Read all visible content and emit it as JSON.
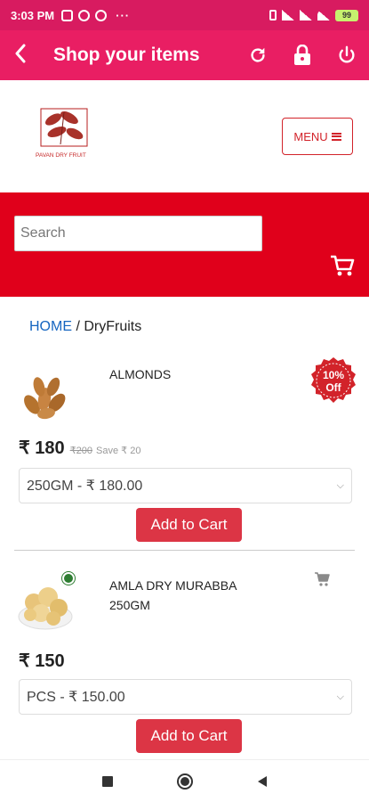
{
  "status_bar": {
    "time": "3:03 PM",
    "dots": "···",
    "battery": "99"
  },
  "app_bar": {
    "title": "Shop your items"
  },
  "header": {
    "menu_label": "MENU",
    "logo_text": "PAVAN DRY FRUIT"
  },
  "search": {
    "placeholder": "Search"
  },
  "breadcrumb": {
    "home": "HOME",
    "separator": " / ",
    "current": "DryFruits"
  },
  "products": [
    {
      "name": "ALMONDS",
      "price": "₹ 180",
      "old_price": "₹200",
      "save": "Save ₹ 20",
      "variant": "250GM - ₹ 180.00",
      "button": "Add to Cart",
      "discount_line1": "10%",
      "discount_line2": "Off"
    },
    {
      "name": "AMLA DRY MURABBA 250GM",
      "price": "₹ 150",
      "variant": "PCS - ₹ 150.00",
      "button": "Add to Cart"
    }
  ],
  "colors": {
    "status_bar": "#d81b60",
    "app_bar": "#e91e63",
    "search_band": "#e0001b",
    "button": "#dc3545",
    "link": "#1565c0"
  },
  "icons": [
    "back-icon",
    "refresh-icon",
    "lock-icon",
    "power-icon",
    "hamburger-icon",
    "cart-icon",
    "veg-icon",
    "nav-square-icon",
    "nav-circle-icon",
    "nav-back-icon"
  ]
}
